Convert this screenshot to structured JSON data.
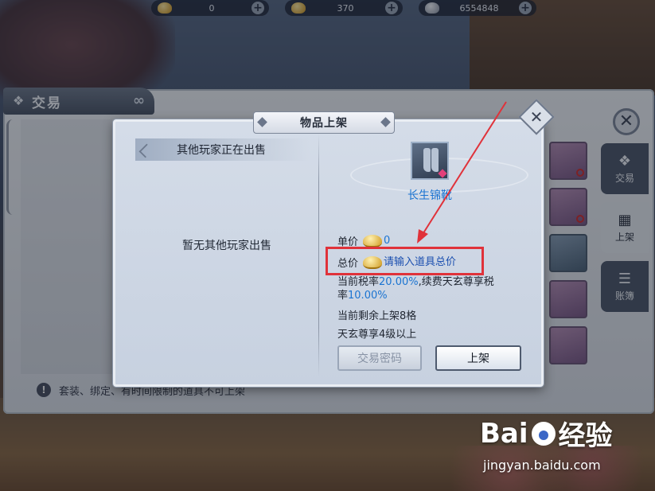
{
  "currency": [
    {
      "icon": "gold-ingot-icon",
      "value": "0"
    },
    {
      "icon": "gold-ingot-icon",
      "value": "370"
    },
    {
      "icon": "silver-ingot-icon",
      "value": "6554848"
    }
  ],
  "trade_window": {
    "title": "交易",
    "side_tabs": [
      {
        "label": "交易",
        "icon": "trade-icon"
      },
      {
        "label": "上架",
        "icon": "shelf-icon"
      },
      {
        "label": "账簿",
        "icon": "ledger-icon"
      }
    ],
    "footer_note": "套装、绑定、有时间限制的道具不可上架"
  },
  "dialog": {
    "title": "物品上架",
    "others_header": "其他玩家正在出售",
    "empty_message": "暂无其他玩家出售",
    "item": {
      "name": "长生锦靴",
      "icon": "boots-icon"
    },
    "unit_price": {
      "label": "单价",
      "value": "0"
    },
    "total_price": {
      "label": "总价",
      "placeholder": "请输入道具总价"
    },
    "tax": {
      "prefix": "当前税率",
      "rate": "20.00%",
      "middle": ",续费天玄尊享税",
      "line2_prefix": "率",
      "rate2": "10.00%"
    },
    "remaining": "当前剩余上架8格",
    "requirement": "天玄尊享4级以上",
    "buttons": {
      "password": "交易密码",
      "list": "上架"
    }
  },
  "watermark": {
    "brand_left": "Bai",
    "brand_right": "经验",
    "url": "jingyan.baidu.com"
  },
  "colors": {
    "link_blue": "#1b74d1",
    "highlight_red": "#e0323a"
  }
}
